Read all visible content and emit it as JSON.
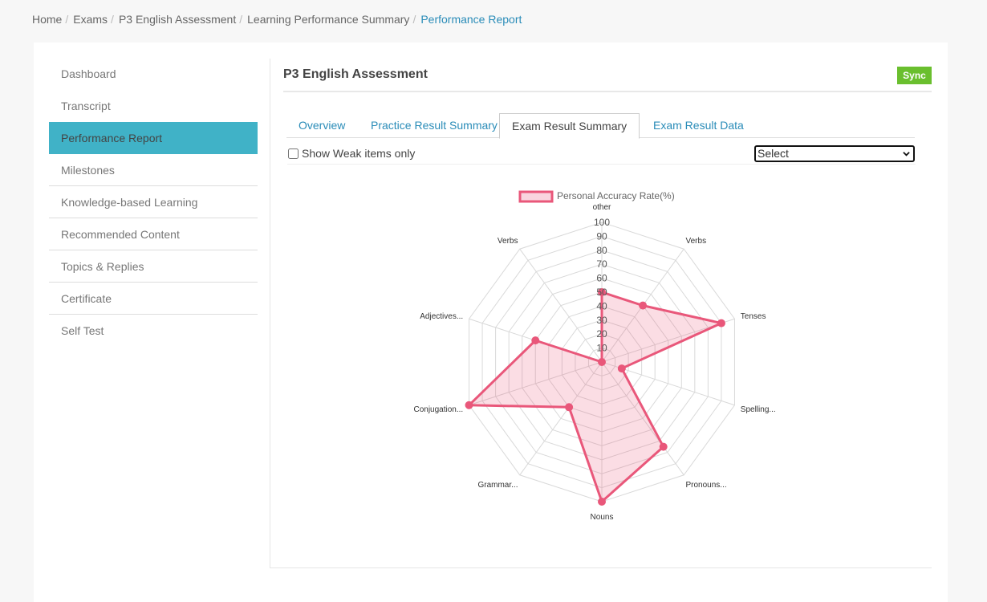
{
  "breadcrumb": [
    "Home",
    "Exams",
    "P3 English Assessment",
    "Learning Performance Summary",
    "Performance Report"
  ],
  "sidebar": {
    "items": [
      "Dashboard",
      "Transcript",
      "Performance Report",
      "Milestones",
      "Knowledge-based Learning",
      "Recommended Content",
      "Topics & Replies",
      "Certificate",
      "Self Test"
    ]
  },
  "main": {
    "title": "P3 English Assessment",
    "sync_label": "Sync",
    "tabs": [
      "Overview",
      "Practice Result Summary",
      "Exam Result Summary",
      "Exam Result Data"
    ],
    "weak_label": "Show Weak items only",
    "select_value": "Select"
  },
  "colors": {
    "accent": "#40b2c7",
    "link": "#2a8cb8",
    "sync": "#6abf2e",
    "series": "#e9577a"
  },
  "chart_data": {
    "type": "radar",
    "legend": "Personal Accuracy Rate(%)",
    "labels": [
      "other",
      "Verbs",
      "Tenses",
      "Spelling...",
      "Pronouns...",
      "Nouns",
      "Grammar...",
      "Conjugation...",
      "Adjectives...",
      "Verbs"
    ],
    "ticks": [
      10,
      20,
      30,
      40,
      50,
      60,
      70,
      80,
      90,
      100
    ],
    "rmin": 0,
    "rmax": 100,
    "series": [
      {
        "name": "Personal Accuracy Rate(%)",
        "values": [
          50,
          50,
          90,
          15,
          75,
          100,
          40,
          100,
          50,
          0
        ]
      }
    ]
  }
}
